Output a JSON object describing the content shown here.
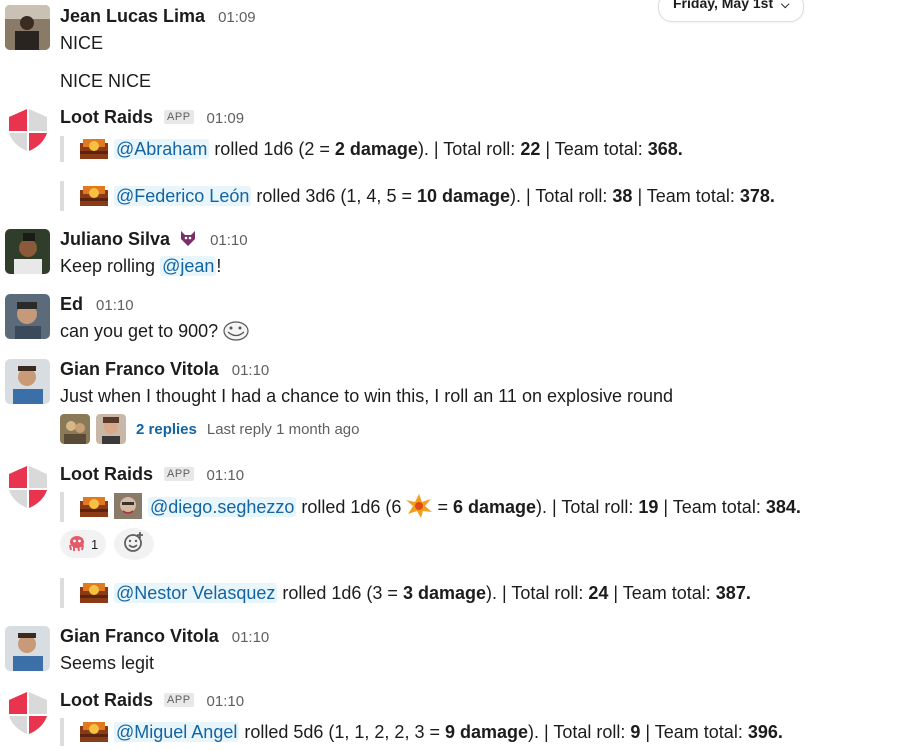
{
  "date_divider": "Friday, May 1st",
  "app_badge": "APP",
  "messages": [
    {
      "name": "Jean Lucas Lima",
      "time": "01:09",
      "lines": [
        "NICE",
        "NICE NICE"
      ]
    },
    {
      "name": "Loot Raids",
      "time": "01:09",
      "rolls": [
        {
          "mention": "@Abraham",
          "t1": " rolled 1d6 (2 = ",
          "dmg": "2 damage",
          "t2": "). | Total roll: ",
          "total": "22",
          "t3": " | Team total: ",
          "team": "368."
        },
        {
          "mention": "@Federico León",
          "t1": " rolled 3d6 (1, 4, 5 = ",
          "dmg": "10 damage",
          "t2": "). | Total roll: ",
          "total": "38",
          "t3": " | Team total: ",
          "team": "378."
        }
      ]
    },
    {
      "name": "Juliano Silva",
      "time": "01:10",
      "pre": "Keep rolling ",
      "mention": "@jean",
      "post": "!"
    },
    {
      "name": "Ed",
      "time": "01:10",
      "text": "can you get to 900?"
    },
    {
      "name": "Gian Franco Vitola",
      "time": "01:10",
      "text": "Just when I thought I had a chance to win this, I roll an 11 on explosive round",
      "thread": {
        "replies": "2 replies",
        "last": "Last reply 1 month ago"
      }
    },
    {
      "name": "Loot Raids",
      "time": "01:10",
      "rolls": [
        {
          "mention": "@diego.seghezzo",
          "t1": " rolled 1d6 (6 ",
          "t1b": " = ",
          "dmg": "6 damage",
          "t2": "). | Total roll: ",
          "total": "19",
          "t3": " | Team total: ",
          "team": "384."
        },
        {
          "mention": "@Nestor Velasquez",
          "t1": " rolled 1d6 (3 = ",
          "dmg": "3 damage",
          "t2": "). | Total roll: ",
          "total": "24",
          "t3": " | Team total: ",
          "team": "387."
        }
      ],
      "reaction_count": "1"
    },
    {
      "name": "Gian Franco Vitola",
      "time": "01:10",
      "text": "Seems legit"
    },
    {
      "name": "Loot Raids",
      "time": "01:10",
      "rolls": [
        {
          "mention": "@Miguel Angel",
          "t1": " rolled 5d6 (1, 1, 2, 2, 3 = ",
          "dmg": "9 damage",
          "t2": "). | Total roll: ",
          "total": "9",
          "t3": " | Team total: ",
          "team": "396."
        }
      ]
    }
  ],
  "icons": {
    "loot_logo": "shield-logo-icon",
    "treasure": "treasure-chest-icon",
    "explosion": "explosion-emoji-icon",
    "trollface": "trollface-emoji-icon",
    "badge": "wolf-badge-icon",
    "add_reaction": "add-reaction-icon",
    "reaction_emoji": "octopus-emoji-icon"
  },
  "colors": {
    "mention_text": "#1264a3",
    "mention_bg": "#e8f5fa",
    "loot_red": "#e8344e"
  }
}
